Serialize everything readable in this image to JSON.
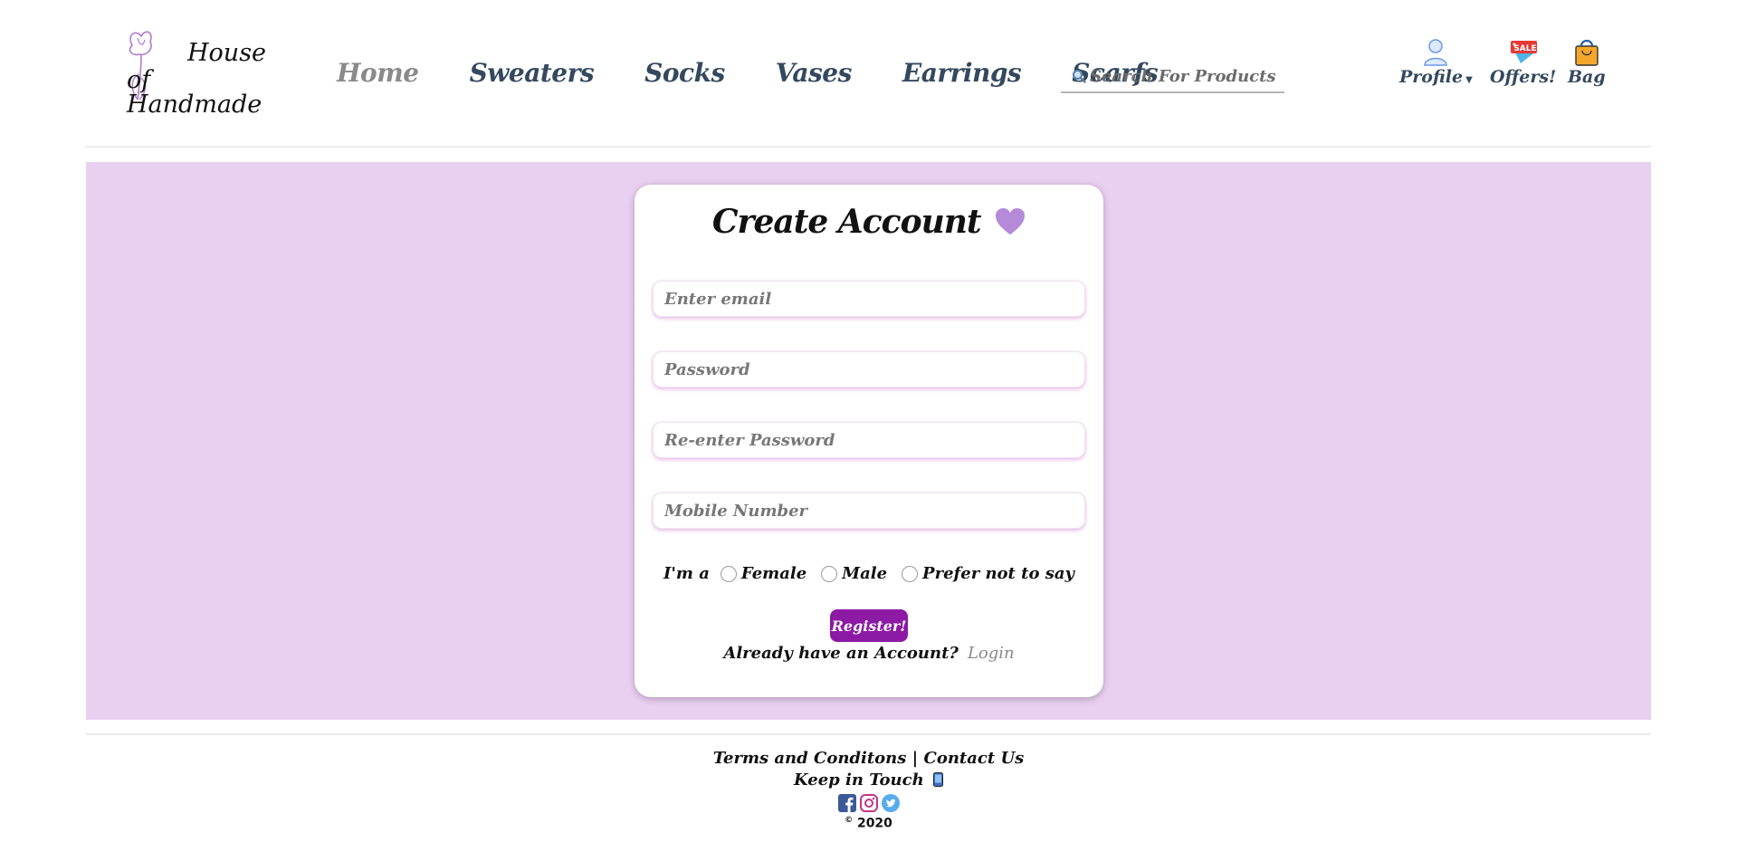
{
  "brand": {
    "line1": "House",
    "line2": "of Handmade"
  },
  "nav": {
    "items": [
      {
        "label": "Home",
        "active": true
      },
      {
        "label": "Sweaters",
        "active": false
      },
      {
        "label": "Socks",
        "active": false
      },
      {
        "label": "Vases",
        "active": false
      },
      {
        "label": "Earrings",
        "active": false
      },
      {
        "label": "Scarfs",
        "active": false
      }
    ]
  },
  "search": {
    "placeholder": "Search For Products",
    "icon": "search-icon"
  },
  "header_icons": {
    "profile": {
      "label": "Profile",
      "icon": "user-icon"
    },
    "offers": {
      "label": "Offers!",
      "badge": "SALE",
      "icon": "sale-tag-icon"
    },
    "bag": {
      "label": "Bag",
      "icon": "shopping-bag-icon"
    }
  },
  "form": {
    "title": "Create Account",
    "title_icon": "heart-icon",
    "email_placeholder": "Enter email",
    "password_placeholder": "Password",
    "reenter_placeholder": "Re-enter Password",
    "mobile_placeholder": "Mobile Number",
    "gender_label": "I'm a",
    "gender_options": [
      "Female",
      "Male",
      "Prefer not to say"
    ],
    "register_label": "Register!",
    "already_text": "Already have an Account?",
    "login_label": "Login"
  },
  "footer": {
    "terms": "Terms and Conditons",
    "separator": "|",
    "contact": "Contact Us",
    "keep_in_touch": "Keep in Touch",
    "social": [
      "facebook-icon",
      "instagram-icon",
      "twitter-icon"
    ],
    "copyright_symbol": "©",
    "year": "2020"
  },
  "colors": {
    "accent": "#8c1aa4",
    "main_bg": "#e9cff0",
    "heart": "#b48ad9",
    "nav_text": "#34495e"
  }
}
